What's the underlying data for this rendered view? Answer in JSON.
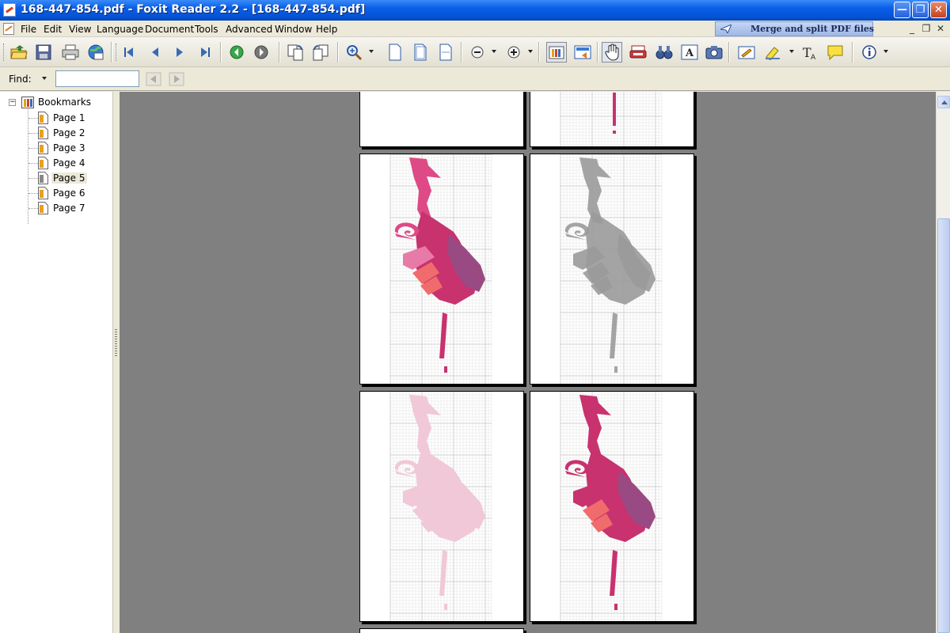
{
  "window": {
    "title": "168-447-854.pdf - Foxit Reader 2.2 - [168-447-854.pdf]",
    "min_glyph": "—",
    "max_glyph": "❐",
    "close_glyph": "✕"
  },
  "menu": {
    "items": [
      "File",
      "Edit",
      "View",
      "Language",
      "Document",
      "Tools",
      "Advanced",
      "Window",
      "Help"
    ],
    "merge_label": "Merge and split PDF files",
    "mdi_min": "_",
    "mdi_restore": "❐",
    "mdi_close": "✕"
  },
  "toolbar": {
    "buttons": [
      "open-icon",
      "save-icon",
      "print-icon",
      "email-icon",
      "first-page-icon",
      "previous-page-icon",
      "next-page-icon",
      "last-page-icon",
      "go-back-icon",
      "go-forward-icon",
      "rotate-left-icon",
      "rotate-right-icon",
      "zoom-in-icon",
      "actual-size-icon",
      "fit-page-icon",
      "fit-width-icon",
      "zoom-out-icon",
      "zoom-plus-icon",
      "bookmark-panel-icon",
      "thumbnail-icon",
      "hand-tool-icon",
      "typewriter-tool-icon",
      "find-binoculars-icon",
      "text-select-icon",
      "snapshot-icon",
      "edit-note-icon",
      "highlight-tool-icon",
      "text-tool-icon",
      "comment-icon",
      "info-icon"
    ]
  },
  "find": {
    "label": "Find:",
    "value": ""
  },
  "bookmarks": {
    "root_label": "Bookmarks",
    "items": [
      "Page 1",
      "Page 2",
      "Page 3",
      "Page 4",
      "Page 5",
      "Page 6",
      "Page 7"
    ],
    "selected": "Page 5"
  },
  "document": {
    "pages": [
      {
        "id": "page-top-left",
        "variant": "blank"
      },
      {
        "id": "page-top-right",
        "variant": "pink-partial"
      },
      {
        "id": "page-color",
        "variant": "pink"
      },
      {
        "id": "page-gray",
        "variant": "gray"
      },
      {
        "id": "page-faded",
        "variant": "faded"
      },
      {
        "id": "page-vivid",
        "variant": "vivid"
      }
    ]
  },
  "colors": {
    "dark_pink": "#c8326e",
    "pink": "#dd4a86",
    "light_pink": "#e87aa8",
    "plum": "#9a4a82",
    "coral": "#f06b6b",
    "gray": "#9a9a9a",
    "faded_pink": "#f0c8d8",
    "viewer_bg": "#808080"
  }
}
